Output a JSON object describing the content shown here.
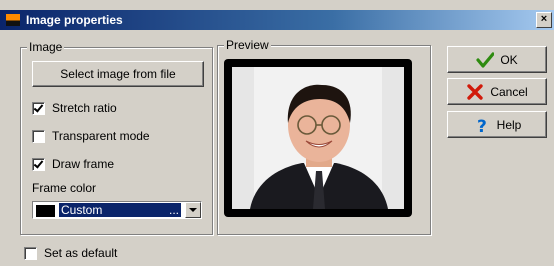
{
  "window": {
    "title": "Image properties",
    "close_glyph": "×"
  },
  "image_group": {
    "legend": "Image",
    "select_button": "Select image from file",
    "checkboxes": [
      {
        "label": "Stretch ratio",
        "checked": true
      },
      {
        "label": "Transparent mode",
        "checked": false
      },
      {
        "label": "Draw frame",
        "checked": true
      }
    ],
    "frame_color_label": "Frame color",
    "frame_color": {
      "value": "Custom",
      "ellipsis": "...",
      "swatch_color": "#000000"
    }
  },
  "preview_group": {
    "legend": "Preview"
  },
  "buttons": {
    "ok": "OK",
    "cancel": "Cancel",
    "help": "Help"
  },
  "set_default": {
    "label": "Set as default",
    "checked": false
  },
  "colors": {
    "title_bar": "#0a246a",
    "selection": "#0a246a",
    "ok_icon": "#2e8b10",
    "cancel_icon": "#d11a0a",
    "help_icon": "#0066cc"
  }
}
